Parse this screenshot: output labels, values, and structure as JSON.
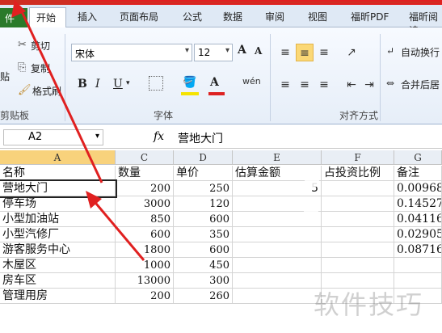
{
  "tabs": [
    "件",
    "开始",
    "插入",
    "页面布局",
    "公式",
    "数据",
    "审阅",
    "视图",
    "福昕PDF",
    "福昕阅读"
  ],
  "ribbon": {
    "clipboard": {
      "cut": "剪切",
      "copy": "复制",
      "paste": "贴",
      "format_painter": "格式刷",
      "label": "剪贴板"
    },
    "font": {
      "name": "宋体",
      "size": "12",
      "grow": "A",
      "shrink": "A",
      "bold": "B",
      "italic": "I",
      "underline": "U",
      "color_letter": "A",
      "wen": "wén",
      "label": "字体"
    },
    "alignment": {
      "wrap": "自动换行",
      "merge": "合并后居",
      "label": "对齐方式"
    }
  },
  "formula": {
    "cell": "A2",
    "fx": "fx",
    "value": "营地大门"
  },
  "columns": [
    "A",
    "C",
    "D",
    "E",
    "F",
    "G"
  ],
  "rows": [
    {
      "a": "名称",
      "c": "数量",
      "d": "单价",
      "e": "估算金额",
      "f": "占投资比例",
      "g": "备注"
    },
    {
      "a": "营地大门",
      "c": "200",
      "d": "250",
      "e": "5",
      "f": "",
      "g": "0.00968"
    },
    {
      "a": "停车场",
      "c": "3000",
      "d": "120",
      "e": "",
      "f": "",
      "g": "0.14527"
    },
    {
      "a": "小型加油站",
      "c": "850",
      "d": "600",
      "e": "",
      "f": "",
      "g": "0.04116"
    },
    {
      "a": "小型汽修厂",
      "c": "600",
      "d": "350",
      "e": "",
      "f": "",
      "g": "0.02905"
    },
    {
      "a": "游客服务中心",
      "c": "1800",
      "d": "600",
      "e": "",
      "f": "",
      "g": "0.08716"
    },
    {
      "a": "木屋区",
      "c": "1000",
      "d": "450",
      "e": "",
      "f": "",
      "g": ""
    },
    {
      "a": "房车区",
      "c": "13000",
      "d": "300",
      "e": "",
      "f": "",
      "g": ""
    },
    {
      "a": "管理用房",
      "c": "200",
      "d": "260",
      "e": "",
      "f": "",
      "g": ""
    }
  ],
  "watermark": "软件技巧",
  "colors": {
    "accent": "#e02020",
    "selected_fill": "#fbd876"
  }
}
